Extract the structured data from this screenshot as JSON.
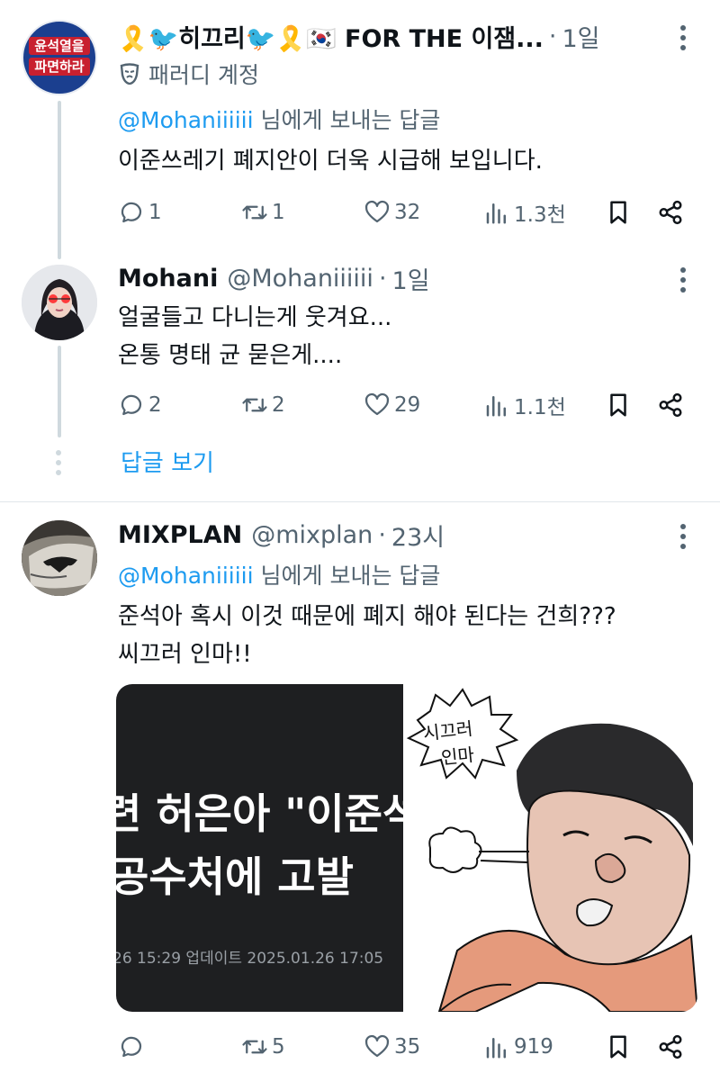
{
  "tweets": [
    {
      "display_name": "🎗️🐦히끄리🐦🎗️🇰🇷 FOR THE 이잼...",
      "dot": "·",
      "time": "1일",
      "parody_label": "패러디 계정",
      "avatar_text_1": "윤석열을",
      "avatar_text_2": "파면하라",
      "reply_prefix": "@Mohaniiiiii",
      "reply_suffix": " 님에게 보내는 답글",
      "lines": [
        "이준쓰레기 폐지안이 더욱 시급해 보입니다."
      ],
      "replies": "1",
      "retweets": "1",
      "likes": "32",
      "views": "1.3천"
    },
    {
      "display_name": "Mohani",
      "handle": "@Mohaniiiiii",
      "dot": "·",
      "time": "1일",
      "lines": [
        "얼굴들고 다니는게 웃겨요...",
        "온통 명태 균 묻은게...."
      ],
      "replies": "2",
      "retweets": "2",
      "likes": "29",
      "views": "1.1천"
    },
    {
      "display_name": "MIXPLAN",
      "handle": "@mixplan",
      "dot": "·",
      "time": "23시",
      "reply_prefix": "@Mohaniiiiii",
      "reply_suffix": " 님에게 보내는 답글",
      "lines": [
        "준석아 혹시 이것 때문에 폐지 해야 된다는 건희???",
        "씨끄러 인마!!"
      ],
      "replies": "",
      "retweets": "5",
      "likes": "35",
      "views": "919"
    }
  ],
  "show_replies": "답글 보기",
  "media": {
    "news_line_1": "련 허은아 \"이준석",
    "news_line_2": "공수처에 고발",
    "news_meta": "26 15:29   업데이트 2025.01.26 17:05",
    "cartoon_bubble_1": "시끄러",
    "cartoon_bubble_2": "인마"
  },
  "colors": {
    "link": "#1d9bf0",
    "muted": "#536471",
    "text": "#0f1419",
    "thread_line": "#cfd9de"
  },
  "icons": [
    "reply-icon",
    "retweet-icon",
    "like-icon",
    "views-icon",
    "bookmark-icon",
    "share-icon",
    "more-icon",
    "parody-mask-icon"
  ]
}
